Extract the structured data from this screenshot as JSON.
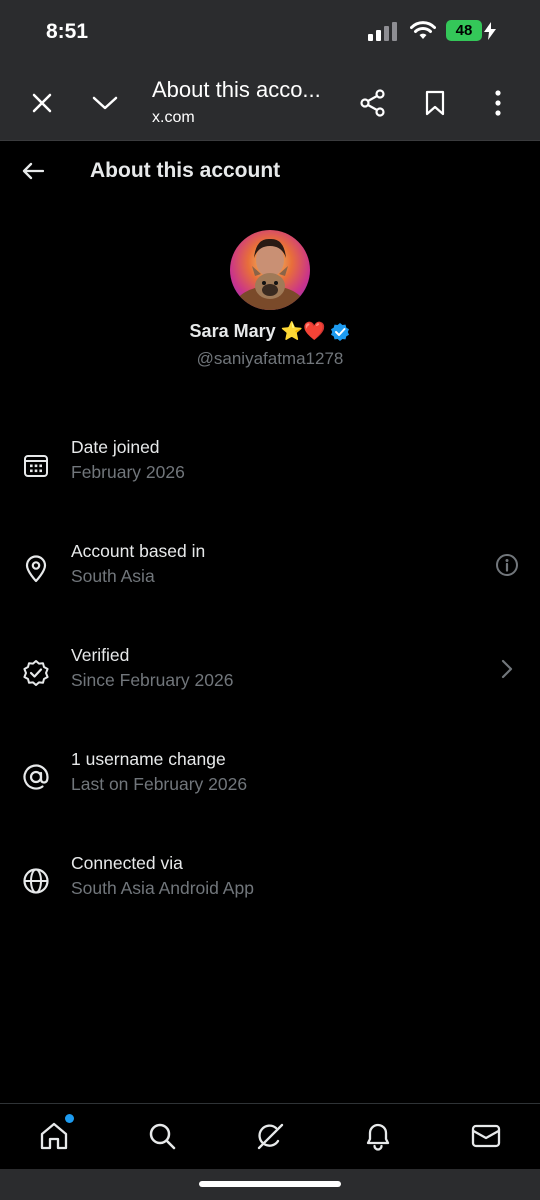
{
  "status_bar": {
    "time": "8:51",
    "battery": "48"
  },
  "browser": {
    "title": "About this acco...",
    "url": "x.com"
  },
  "page": {
    "title": "About this account"
  },
  "profile": {
    "name": "Sara Mary",
    "emoji": "⭐❤️",
    "handle": "@saniyafatma1278"
  },
  "rows": [
    {
      "icon": "calendar-icon",
      "label": "Date joined",
      "value": "February 2026"
    },
    {
      "icon": "location-pin-icon",
      "label": "Account based in",
      "value": "South Asia",
      "trailing": "info-icon"
    },
    {
      "icon": "verified-badge-icon",
      "label": "Verified",
      "value": "Since February 2026",
      "trailing": "chevron-right-icon"
    },
    {
      "icon": "at-sign-icon",
      "label": "1 username change",
      "value": "Last on February 2026"
    },
    {
      "icon": "globe-icon",
      "label": "Connected via",
      "value": "South Asia Android App"
    }
  ],
  "bottom_nav": [
    "home-icon",
    "search-icon",
    "grok-icon",
    "notifications-icon",
    "messages-icon"
  ],
  "colors": {
    "background": "#000000",
    "primary_text": "#e7e9ea",
    "secondary_text": "#71767b",
    "verified_blue": "#1d9bf0",
    "browser_chrome": "#2b2c2e"
  }
}
